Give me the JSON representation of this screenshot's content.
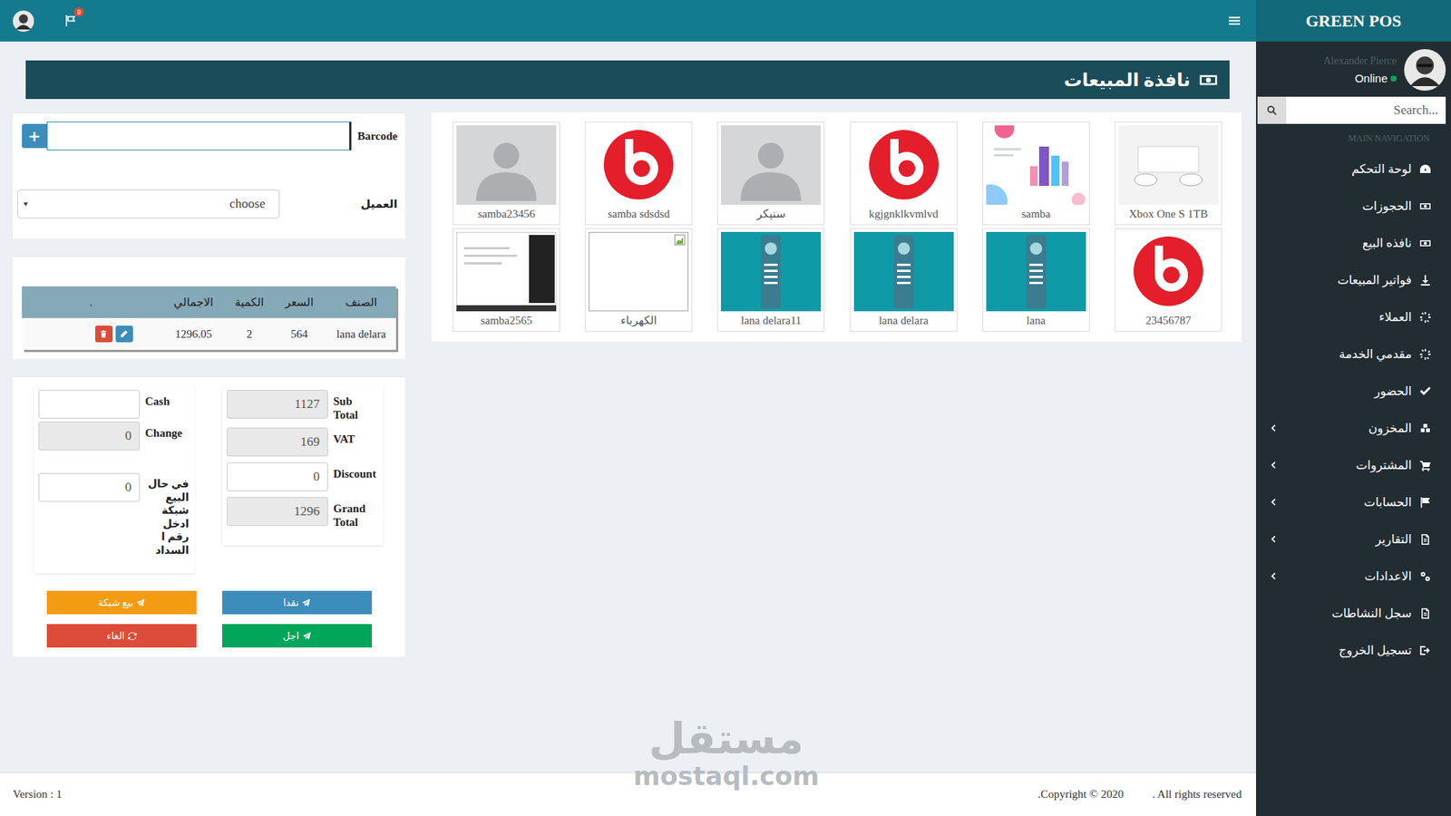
{
  "topbar": {
    "notifications": "9"
  },
  "sidebar": {
    "brand": "GREEN POS",
    "user": {
      "name": "Alexander Pierce",
      "status": "Online",
      "online": true
    },
    "search": {
      "placeholder": "Search..."
    },
    "section": "MAIN NAVIGATION",
    "items": [
      {
        "label": "لوحة التحكم",
        "expandable": false,
        "selected": false
      },
      {
        "label": "الحجوزات",
        "expandable": false,
        "selected": false
      },
      {
        "label": "نافذه البيع",
        "expandable": false,
        "selected": false
      },
      {
        "label": "فواتير المبيعات",
        "expandable": false,
        "selected": false
      },
      {
        "label": "العملاء",
        "expandable": false,
        "selected": false
      },
      {
        "label": "مقدمي الخدمة",
        "expandable": false,
        "selected": false
      },
      {
        "label": "الحضور",
        "expandable": false,
        "selected": false
      },
      {
        "label": "المخزون",
        "expandable": true,
        "selected": false
      },
      {
        "label": "المشتروات",
        "expandable": true,
        "selected": false
      },
      {
        "label": "الحسابات",
        "expandable": true,
        "selected": false
      },
      {
        "label": "التقارير",
        "expandable": true,
        "selected": false
      },
      {
        "label": "الاعدادات",
        "expandable": true,
        "selected": false
      },
      {
        "label": "سجل النشاطات",
        "expandable": false,
        "selected": false
      },
      {
        "label": "تسجيل الخروج",
        "expandable": false,
        "selected": false
      }
    ]
  },
  "page": {
    "title": "نافذة المبيعات"
  },
  "barcode": {
    "label": "Barcode",
    "value": "",
    "add": "+"
  },
  "customer": {
    "label": "العميل",
    "value": "choose"
  },
  "cart": {
    "columns": [
      "الصنف",
      "السعر",
      "الكمية",
      "الاجمالي",
      "."
    ],
    "rows": [
      {
        "cells": [
          "lana delara",
          "564",
          "2",
          "1296.05"
        ]
      }
    ]
  },
  "summary": [
    {
      "label": "Sub Total",
      "value": "1127",
      "editable": false
    },
    {
      "label": "VAT",
      "value": "169",
      "editable": false
    },
    {
      "label": "Discount",
      "value": "0",
      "editable": true
    },
    {
      "label": "Grand Total",
      "value": "1296",
      "editable": false
    }
  ],
  "payment": [
    {
      "label": "Cash",
      "value": "",
      "editable": true
    },
    {
      "label": "Change",
      "value": "0",
      "editable": false
    },
    {
      "label": "في حال البيع شبكة ادخل رقم ا السداد",
      "value": "0",
      "editable": true
    }
  ],
  "actions": [
    {
      "label": "بيع شبكة",
      "color": "#f39c12",
      "kind": "send"
    },
    {
      "label": "نقدا",
      "color": "#3c8dbc",
      "kind": "send"
    },
    {
      "label": "الغاء",
      "color": "#dd4b39",
      "kind": "reset"
    },
    {
      "label": "اجل",
      "color": "#00a65a",
      "kind": "send"
    }
  ],
  "products": [
    {
      "name": "Xbox One S 1TB",
      "kind": "console"
    },
    {
      "name": "samba",
      "kind": "illustration"
    },
    {
      "name": "kgjgnklkvmlvd",
      "kind": "logo"
    },
    {
      "name": "سنيكر",
      "kind": "placeholder"
    },
    {
      "name": "samba sdsdsd",
      "kind": "logo"
    },
    {
      "name": "samba23456",
      "kind": "placeholder"
    },
    {
      "name": "23456787",
      "kind": "logo"
    },
    {
      "name": "lana",
      "kind": "app"
    },
    {
      "name": "lana delara",
      "kind": "app"
    },
    {
      "name": "lana delara11",
      "kind": "app"
    },
    {
      "name": "الكهرباء",
      "kind": "broken"
    },
    {
      "name": "samba2565",
      "kind": "screenshot"
    }
  ],
  "footer": {
    "version": "Version : 1",
    "copyright": ".Copyright © 2020",
    "rights": ". All rights reserved"
  },
  "watermark": {
    "arabic": "مستقل",
    "latin": "mostaql.com"
  }
}
